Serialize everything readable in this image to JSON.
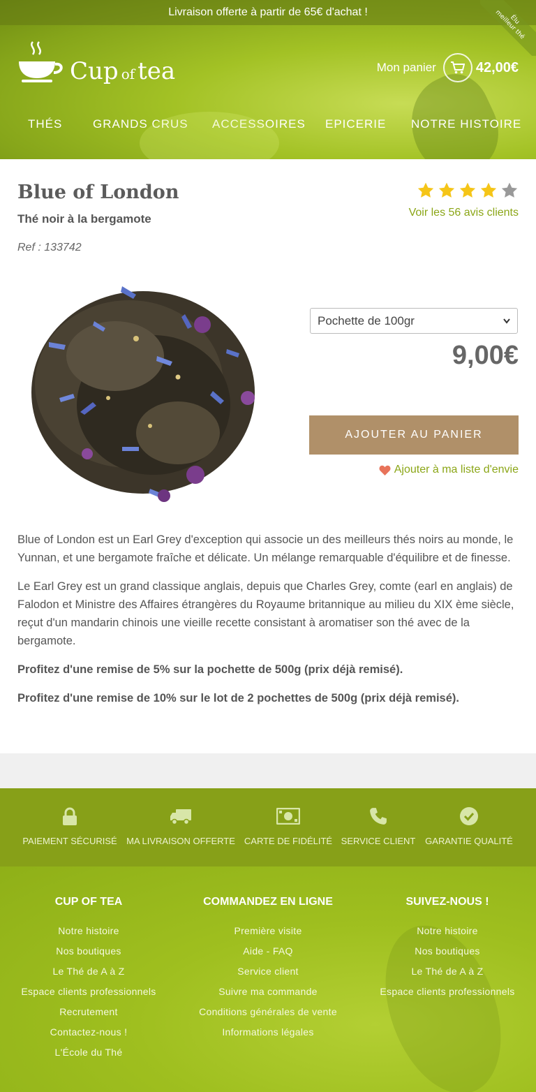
{
  "topbar": {
    "text": "Livraison offerte à partir de 65€ d'achat !"
  },
  "ribbon": {
    "line1": "Élu",
    "line2": "meilleur thé"
  },
  "logo": {
    "word1": "Cup",
    "word2": "of",
    "word3": "tea"
  },
  "cart": {
    "label": "Mon panier",
    "total": "42,00€",
    "icon": "cart-icon"
  },
  "nav": {
    "items": [
      "THÉS",
      "GRANDS CRUS",
      "ACCESSOIRES",
      "EPICERIE",
      "NOTRE HISTOIRE"
    ]
  },
  "product": {
    "title": "Blue of London",
    "subtitle": "Thé noir à la bergamote",
    "ref": "Ref : 133742",
    "rating": 4,
    "rating_max": 5,
    "reviews_link": "Voir les 56 avis clients",
    "select_value": "Pochette de 100gr",
    "price": "9,00€",
    "add_to_cart": "AJOUTER AU PANIER",
    "wishlist": "Ajouter à ma liste d'envie",
    "description": [
      "Blue of London est un Earl Grey d'exception qui associe un des meilleurs thés noirs au monde, le Yunnan, et une bergamote fraîche et délicate. Un mélange remarquable d'équilibre et de finesse.",
      "Le Earl Grey est un grand classique anglais, depuis que Charles Grey, comte (earl en anglais) de Falodon et Ministre des Affaires étrangères du Royaume britannique au milieu du XIX ème siècle, reçut d'un mandarin chinois une vieille recette consistant à aromatiser son thé avec de la bergamote."
    ],
    "promos": [
      "Profitez d'une remise de 5% sur la pochette de 500g (prix déjà remisé).",
      "Profitez d'une remise de 10% sur le lot de 2 pochettes de 500g (prix déjà remisé)."
    ]
  },
  "features": [
    {
      "label": "PAIEMENT SÉCURISÉ",
      "icon": "lock-icon"
    },
    {
      "label": "MA LIVRAISON OFFERTE",
      "icon": "truck-icon"
    },
    {
      "label": "CARTE DE FIDÉLITÉ",
      "icon": "banknote-icon"
    },
    {
      "label": "SERVICE CLIENT",
      "icon": "phone-icon"
    },
    {
      "label": "GARANTIE QUALITÉ",
      "icon": "check-circle-icon"
    }
  ],
  "footer": {
    "columns": [
      {
        "title": "CUP OF TEA",
        "links": [
          "Notre histoire",
          "Nos boutiques",
          "Le Thé de A à Z",
          "Espace clients professionnels",
          "Recrutement",
          "Contactez-nous !",
          "L'École du Thé"
        ]
      },
      {
        "title": "COMMANDEZ EN LIGNE",
        "links": [
          "Première visite",
          "Aide - FAQ",
          "Service client",
          "Suivre ma commande",
          "Conditions générales de vente",
          "Informations légales"
        ]
      },
      {
        "title": "SUIVEZ-NOUS !",
        "links": [
          "Notre histoire",
          "Nos boutiques",
          "Le Thé de A à Z",
          "Espace clients professionnels"
        ]
      }
    ]
  },
  "colors": {
    "accent": "#8ba617",
    "button": "#b09069",
    "star": "#f5c518",
    "star_empty": "#999999",
    "heart": "#e8735a"
  }
}
